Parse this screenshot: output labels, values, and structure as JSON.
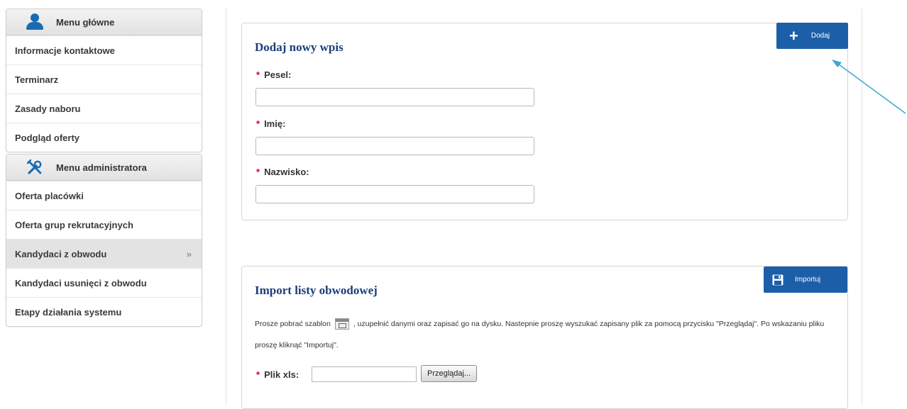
{
  "sidebar": {
    "main_menu": {
      "title": "Menu główne",
      "icon": "user-icon",
      "items": [
        {
          "label": "Informacje kontaktowe"
        },
        {
          "label": "Terminarz"
        },
        {
          "label": "Zasady naboru"
        },
        {
          "label": "Podgląd oferty"
        }
      ]
    },
    "admin_menu": {
      "title": "Menu administratora",
      "icon": "tools-icon",
      "items": [
        {
          "label": "Oferta placówki"
        },
        {
          "label": "Oferta grup rekrutacyjnych"
        },
        {
          "label": "Kandydaci z obwodu",
          "active": true,
          "chevron": "»"
        },
        {
          "label": "Kandydaci usunięci z obwodu"
        },
        {
          "label": "Etapy działania systemu"
        }
      ]
    }
  },
  "add_entry": {
    "title": "Dodaj nowy wpis",
    "add_button": {
      "icon": "plus-icon",
      "icon_glyph": "+",
      "label": "Dodaj"
    },
    "required_mark": "*",
    "fields": [
      {
        "label": "Pesel:",
        "value": "",
        "placeholder": ""
      },
      {
        "label": "Imię:",
        "value": "",
        "placeholder": ""
      },
      {
        "label": "Nazwisko:",
        "value": "",
        "placeholder": ""
      }
    ]
  },
  "import": {
    "title": "Import listy obwodowej",
    "import_button": {
      "icon": "save-icon",
      "label": "Importuj"
    },
    "text_before_icon": "Prosze pobrać szablon",
    "template_icon": "xls-template-icon",
    "text_after_icon": ", uzupełnić danymi oraz zapisać go na dysku. Nastepnie proszę wyszukać zapisany plik za pomocą przycisku \"Przeglądaj\". Po wskazaniu pliku proszę kliknąć \"Importuj\".",
    "file_label": "Plik xls:",
    "file_value": "",
    "browse_label": "Przeglądaj..."
  },
  "colors": {
    "accent_blue": "#1c5fa8",
    "title_blue": "#1a3e7a",
    "required_red": "#d0021b",
    "annotation_arrow": "#3aa7d6"
  }
}
